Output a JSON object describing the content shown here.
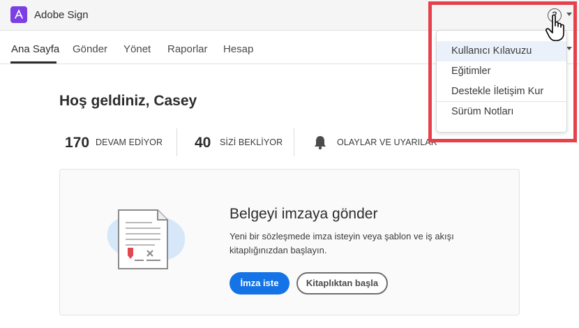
{
  "app": {
    "title": "Adobe Sign",
    "help_symbol": "?"
  },
  "nav": {
    "tabs": [
      {
        "label": "Ana Sayfa"
      },
      {
        "label": "Gönder"
      },
      {
        "label": "Yönet"
      },
      {
        "label": "Raporlar"
      },
      {
        "label": "Hesap"
      }
    ]
  },
  "main": {
    "welcome": "Hoş geldiniz, Casey",
    "stats": [
      {
        "count": "170",
        "label": "DEVAM EDİYOR"
      },
      {
        "count": "40",
        "label": "SİZİ BEKLİYOR"
      },
      {
        "label": "OLAYLAR VE UYARILAR"
      }
    ]
  },
  "card": {
    "title": "Belgeyi imzaya gönder",
    "description": "Yeni bir sözleşmede imza isteyin veya şablon ve iş akışı kitaplığınızdan başlayın.",
    "primary_button": "İmza iste",
    "secondary_button": "Kitaplıktan başla"
  },
  "help_menu": {
    "items": [
      {
        "label": "Kullanıcı Kılavuzu"
      },
      {
        "label": "Eğitimler"
      },
      {
        "label": "Destekle İletişim Kur"
      },
      {
        "label": "Sürüm Notları"
      }
    ]
  },
  "colors": {
    "brand": "#7b3fe4",
    "primary_button": "#1473e6",
    "highlight": "#e8404a"
  },
  "icons": [
    "acrobat-logo-icon",
    "help-icon",
    "chevron-down-icon",
    "bell-icon",
    "document-icon",
    "hand-cursor-icon"
  ]
}
